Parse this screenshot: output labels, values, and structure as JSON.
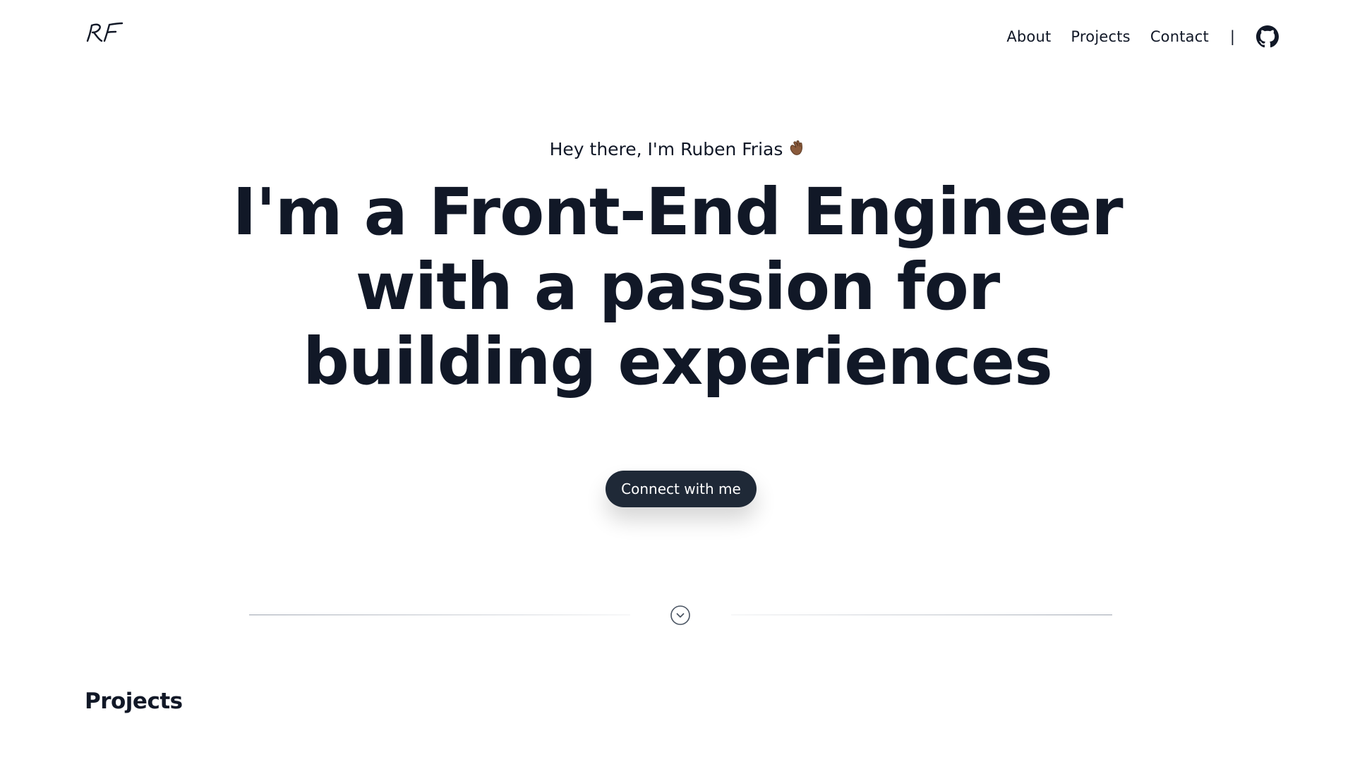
{
  "header": {
    "logo_text": "RF",
    "nav": [
      {
        "label": "About"
      },
      {
        "label": "Projects"
      },
      {
        "label": "Contact"
      }
    ],
    "separator": "|",
    "github_icon": "github-icon"
  },
  "hero": {
    "intro": "Hey there, I'm Ruben Frias",
    "intro_emoji": "waving-hand-emoji",
    "headline_lines": [
      "I'm a Front-End Engineer",
      "with a passion for",
      "building experiences"
    ],
    "cta_label": "Connect with me"
  },
  "divider": {
    "icon": "chevron-down-circle-icon"
  },
  "projects": {
    "title": "Projects"
  },
  "colors": {
    "text": "#111827",
    "button_bg": "#1f2937",
    "button_text": "#ffffff",
    "divider": "#9ca3af",
    "background": "#ffffff"
  }
}
